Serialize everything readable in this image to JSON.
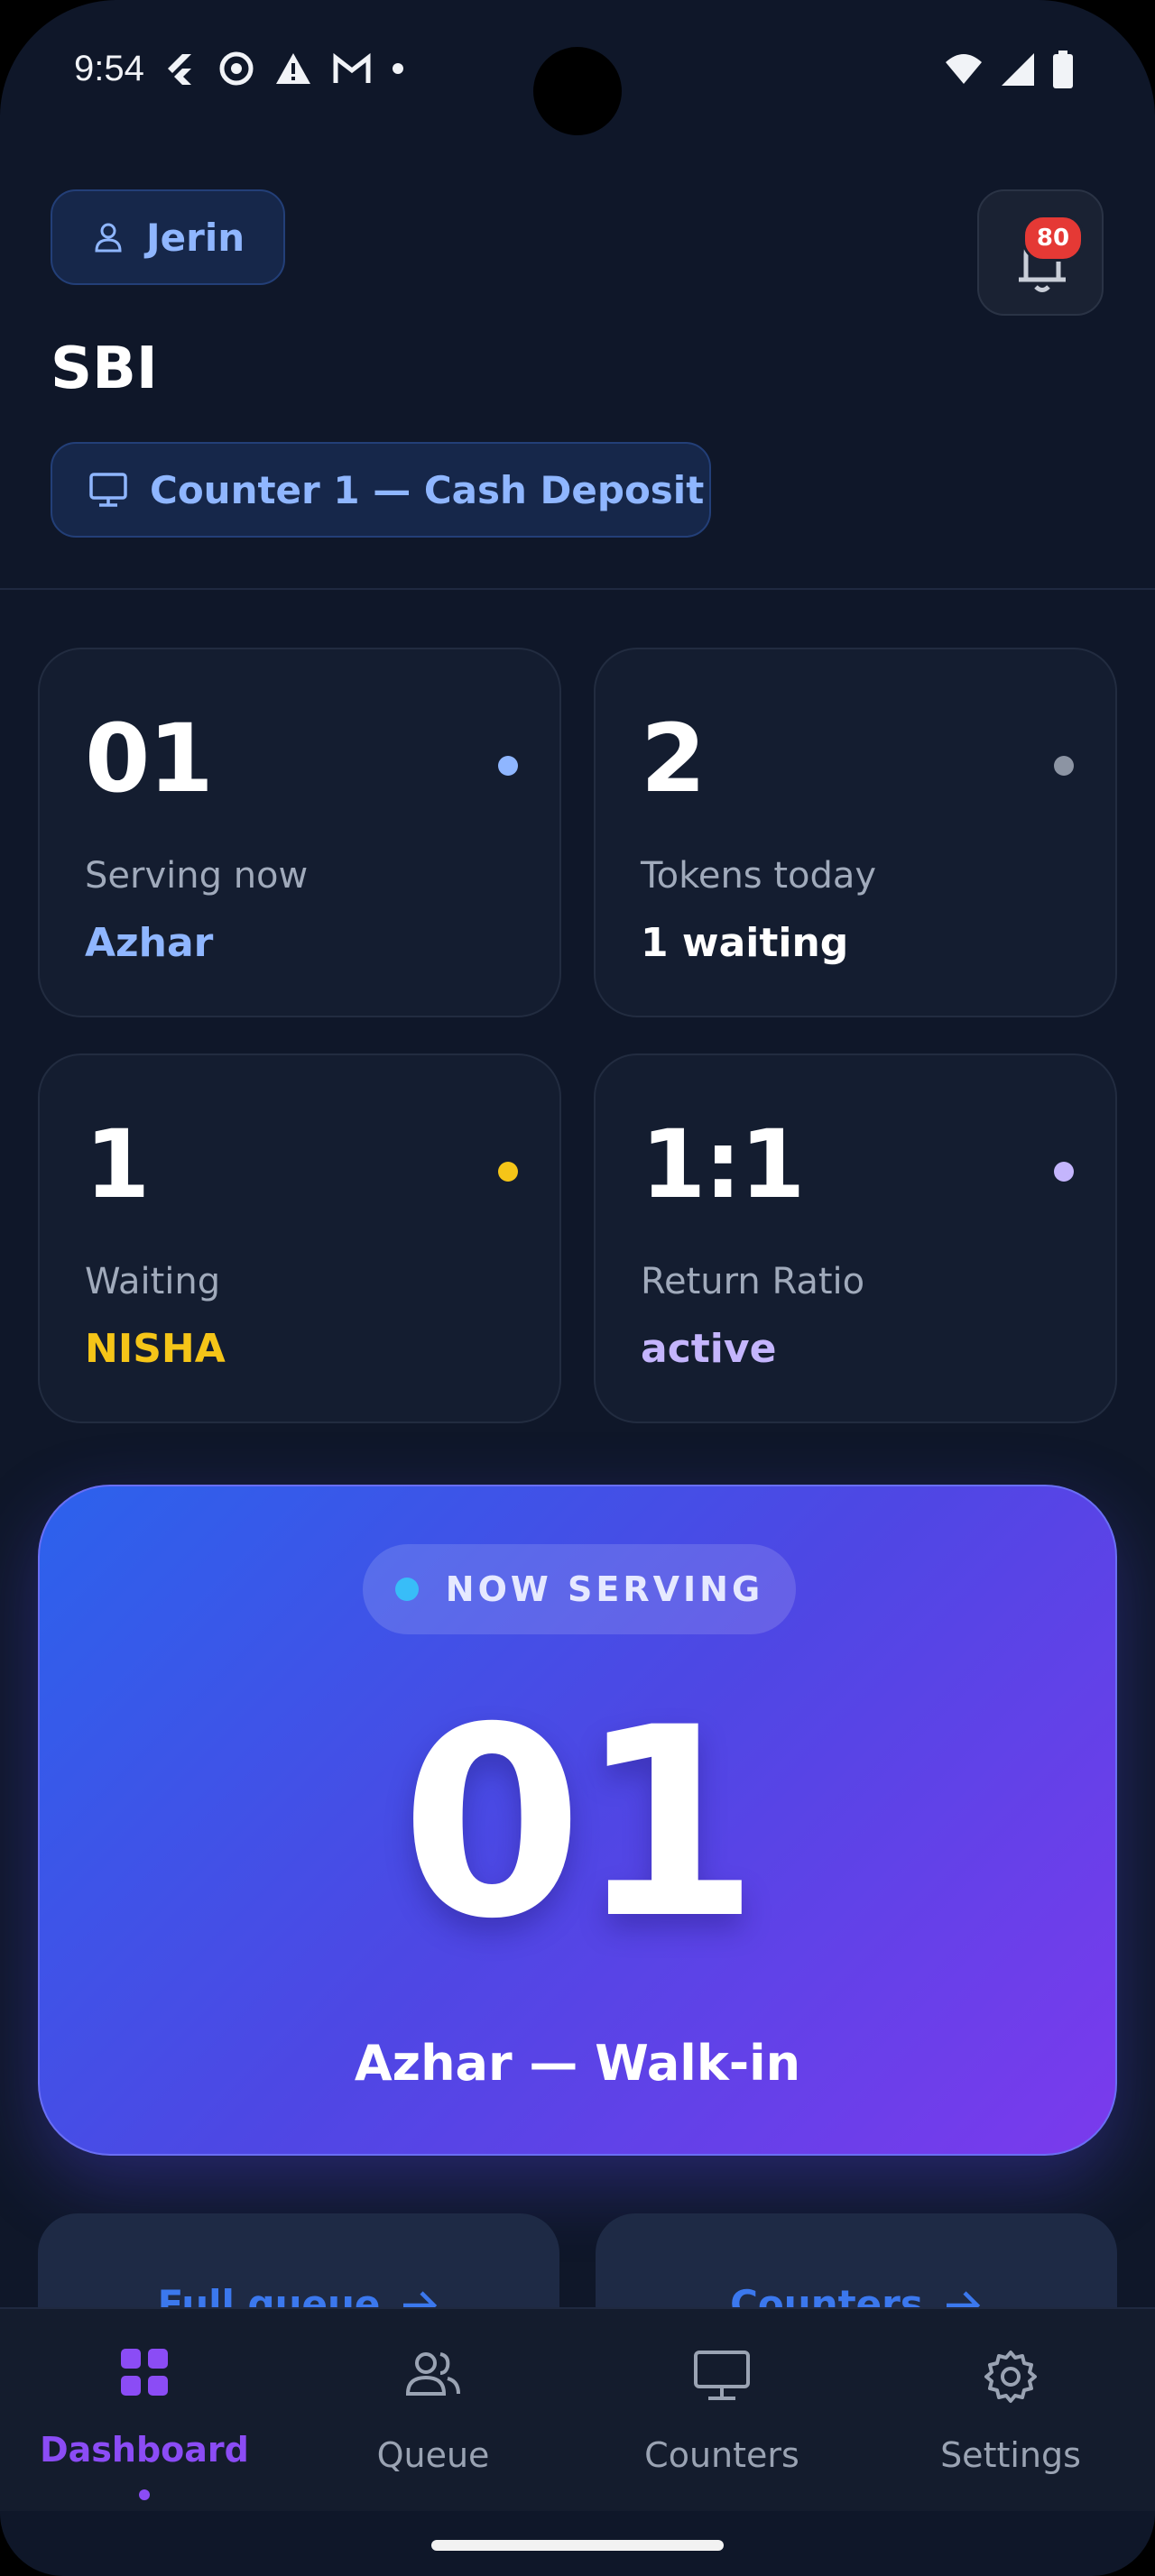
{
  "status_bar": {
    "time": "9:54"
  },
  "header": {
    "user_chip": "Jerin",
    "notification_count": "80",
    "bank_name": "SBI",
    "counter_chip": "Counter 1 — Cash Deposit"
  },
  "stats": [
    {
      "value": "01",
      "label": "Serving now",
      "sub": "Azhar",
      "dot_color": "#8fb6ff",
      "sub_color": "#8fb6ff"
    },
    {
      "value": "2",
      "label": "Tokens today",
      "sub": "1 waiting",
      "dot_color": "#8c94a3",
      "sub_color": "#ffffff"
    },
    {
      "value": "1",
      "label": "Waiting",
      "sub": "NISHA",
      "dot_color": "#f5c518",
      "sub_color": "#f5c518"
    },
    {
      "value": "1:1",
      "label": "Return Ratio",
      "sub": "active",
      "dot_color": "#c4b5fd",
      "sub_color": "#c4b5fd"
    }
  ],
  "now_serving": {
    "label": "NOW SERVING",
    "token": "01",
    "name": "Azhar — Walk-in"
  },
  "actions": [
    {
      "label": "Full queue"
    },
    {
      "label": "Counters"
    }
  ],
  "nav": [
    {
      "label": "Dashboard",
      "icon": "grid-icon",
      "active": true
    },
    {
      "label": "Queue",
      "icon": "people-icon",
      "active": false
    },
    {
      "label": "Counters",
      "icon": "monitor-icon",
      "active": false
    },
    {
      "label": "Settings",
      "icon": "gear-icon",
      "active": false
    }
  ],
  "colors": {
    "accent": "#8b4cf5",
    "background": "#0f1729",
    "link": "#3b78ee"
  }
}
